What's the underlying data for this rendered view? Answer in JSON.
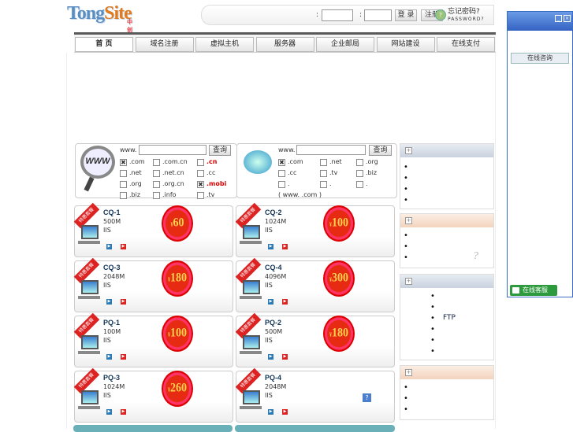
{
  "header": {
    "logo_main": "Tong",
    "logo_site": "Site",
    "logo_sub": "中创科技",
    "login_btn": "登 录",
    "register_btn": "注册",
    "forgot_label": "忘记密码?",
    "forgot_sub": "PASSWORD?",
    "colon": ":"
  },
  "nav": {
    "tabs": [
      {
        "label": "首 页"
      },
      {
        "label": "域名注册"
      },
      {
        "label": "虚拟主机"
      },
      {
        "label": "服务器"
      },
      {
        "label": "企业邮局"
      },
      {
        "label": "网站建设"
      },
      {
        "label": "在线支付"
      }
    ]
  },
  "domain_search": [
    {
      "prefix": "www.",
      "button": "查询",
      "options": [
        {
          "label": ".com",
          "checked": true
        },
        {
          "label": ".com.cn",
          "checked": false
        },
        {
          "label": ".cn",
          "checked": false,
          "red": true
        },
        {
          "label": ".net",
          "checked": false
        },
        {
          "label": ".net.cn",
          "checked": false
        },
        {
          "label": ".cc",
          "checked": false
        },
        {
          "label": ".org",
          "checked": false
        },
        {
          "label": ".org.cn",
          "checked": false
        },
        {
          "label": ".mobi",
          "checked": true,
          "red": true
        },
        {
          "label": ".biz",
          "checked": false
        },
        {
          "label": ".info",
          "checked": false
        },
        {
          "label": ".tv",
          "checked": false
        }
      ]
    },
    {
      "prefix": "www.",
      "button": "查询",
      "options": [
        {
          "label": ".com",
          "checked": true
        },
        {
          "label": ".net",
          "checked": false
        },
        {
          "label": ".org",
          "checked": false
        },
        {
          "label": ".cc",
          "checked": false
        },
        {
          "label": ".tv",
          "checked": false
        },
        {
          "label": ".biz",
          "checked": false
        },
        {
          "label": ".",
          "checked": false
        },
        {
          "label": ".",
          "checked": false
        },
        {
          "label": ".",
          "checked": false
        }
      ],
      "note": "(  www.   .com )"
    }
  ],
  "products": [
    {
      "name": "CQ-1",
      "size": "500M",
      "tech": "IIS",
      "price": "60",
      "badge": "特惠套餐"
    },
    {
      "name": "CQ-2",
      "size": "1024M",
      "tech": "IIS",
      "price": "100",
      "badge": "特惠套餐"
    },
    {
      "name": "CQ-3",
      "size": "2048M",
      "tech": "IIS",
      "price": "180",
      "badge": "特惠套餐"
    },
    {
      "name": "CQ-4",
      "size": "4096M",
      "tech": "IIS",
      "price": "300",
      "badge": "特惠套餐"
    },
    {
      "name": "PQ-1",
      "size": "100M",
      "tech": "IIS",
      "price": "100",
      "badge": "特惠套餐"
    },
    {
      "name": "PQ-2",
      "size": "500M",
      "tech": "IIS",
      "price": "180",
      "badge": "特惠套餐"
    },
    {
      "name": "PQ-3",
      "size": "1024M",
      "tech": "IIS",
      "price": "260",
      "badge": "特惠套餐"
    },
    {
      "name": "PQ-4",
      "size": "2048M",
      "tech": "IIS",
      "price": "",
      "badge": "特惠套餐"
    }
  ],
  "price_currency": "¥",
  "sidebar": {
    "ftp_label": "FTP",
    "bullet": "•"
  },
  "right_panel": {
    "consult_label": "在线咨询",
    "kefu_label": "在线客服",
    "min": "_",
    "close": "×"
  },
  "colors": {
    "accent": "#3463c3",
    "price": "#e62b12",
    "nav_border": "#5a5a5a"
  }
}
